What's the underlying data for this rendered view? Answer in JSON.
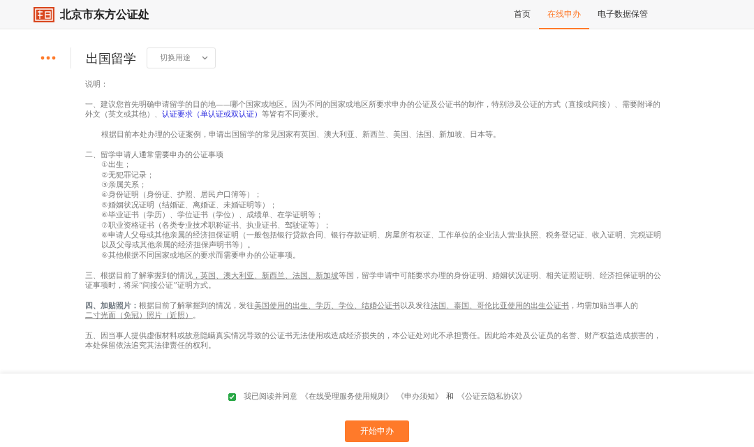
{
  "header": {
    "logo_text": "北京市东方公证处",
    "nav": [
      {
        "label": "首页",
        "selected": false
      },
      {
        "label": "在线申办",
        "selected": true
      },
      {
        "label": "电子数据保管",
        "selected": false
      }
    ]
  },
  "title_bar": {
    "title": "出国留学",
    "dropdown": "切换用途"
  },
  "notes": [
    {
      "kind": "paragraph",
      "segments": [
        {
          "kind": "plain",
          "text": "说明："
        }
      ]
    },
    {
      "kind": "paragraph",
      "segments": [
        {
          "kind": "plain",
          "text": "一、建议您首先明确申请留学的目的地——哪个国家或地区。因为不同的国家或地区所要求申办的公证及公证书的制作，特别涉及公证的方式（直接或间接）、需要附译的外文（英文或其他）、"
        },
        {
          "kind": "link",
          "text": "认证要求（单认证或双认证）"
        },
        {
          "kind": "plain",
          "text": "等皆有不同要求。"
        }
      ]
    },
    {
      "kind": "indented",
      "segments": [
        {
          "kind": "plain",
          "text": "根据目前本处办理的公证案例，申请出国留学的常见国家有英国、澳大利亚、新西兰、美国、法国、新加坡、日本等。"
        }
      ]
    },
    {
      "kind": "list",
      "heading": "二、留学申请人通常需要申办的公证事项",
      "items": [
        "①出生；",
        "②无犯罪记录；",
        "③亲属关系；",
        "④身份证明（身份证、护照、居民户口簿等）；",
        "⑤婚姻状况证明（结婚证、离婚证、未婚证明等）；",
        "⑥毕业证书（学历）、学位证书（学位）、成绩单、在学证明等；",
        "⑦职业资格证书（各类专业技术职称证书、执业证书、驾驶证等）；",
        "⑧申请人父母或其他亲属的经济担保证明（一般包括银行贷款合同、银行存款证明、房屋所有权证、工作单位的企业法人营业执照、税务登记证、收入证明、完税证明以及父母或其他亲属的经济担保声明书等）。",
        "⑨其他根据不同国家或地区的要求而需要申办的公证事项。"
      ]
    },
    {
      "kind": "paragraph",
      "segments": [
        {
          "kind": "plain",
          "text": "三、根据目前了解掌握到的情况"
        },
        {
          "kind": "underline",
          "text": "，英国、澳大利亚、新西兰、法国、新加坡"
        },
        {
          "kind": "plain",
          "text": "等国，留学申请中可能要求办理的身份证明、婚姻状况证明、相关证照证明、经济担保证明的公证事项时，将采“间接公证”证明方式。"
        }
      ]
    },
    {
      "kind": "paragraph",
      "segments": [
        {
          "kind": "bold",
          "text": "四、加贴照片："
        },
        {
          "kind": "plain",
          "text": "根据目前了解掌握到的情况，发往"
        },
        {
          "kind": "underline",
          "text": "美国使用的出生、学历、学位、结婚公证书"
        },
        {
          "kind": "plain",
          "text": "以及发往"
        },
        {
          "kind": "underline",
          "text": "法国、泰国、哥伦比亚使用的出生公证书"
        },
        {
          "kind": "plain",
          "text": "，均需加贴当事人的"
        },
        {
          "kind": "break"
        },
        {
          "kind": "underline",
          "text": "二寸光面（免冠）照片（近照）"
        },
        {
          "kind": "plain",
          "text": "。"
        }
      ]
    },
    {
      "kind": "paragraph",
      "segments": [
        {
          "kind": "plain",
          "text": "五、因当事人提供虚假材料或故意隐瞒真实情况导致的公证书无法使用或造成经济损失的，本公证处对此不承担责任。因此给本处及公证员的名誉、财产权益造成损害的，本处保留依法追究其法律责任的权利。"
        }
      ]
    }
  ],
  "agreement": {
    "checked": true,
    "parts": [
      {
        "kind": "text",
        "text": "我已阅读并同意"
      },
      {
        "kind": "link",
        "text": "《在线受理服务使用规则》"
      },
      {
        "kind": "link",
        "text": "《申办须知》"
      },
      {
        "kind": "text",
        "text": "和"
      },
      {
        "kind": "link",
        "text": "《公证云隐私协议》"
      }
    ]
  },
  "start_button": "开始申办"
}
